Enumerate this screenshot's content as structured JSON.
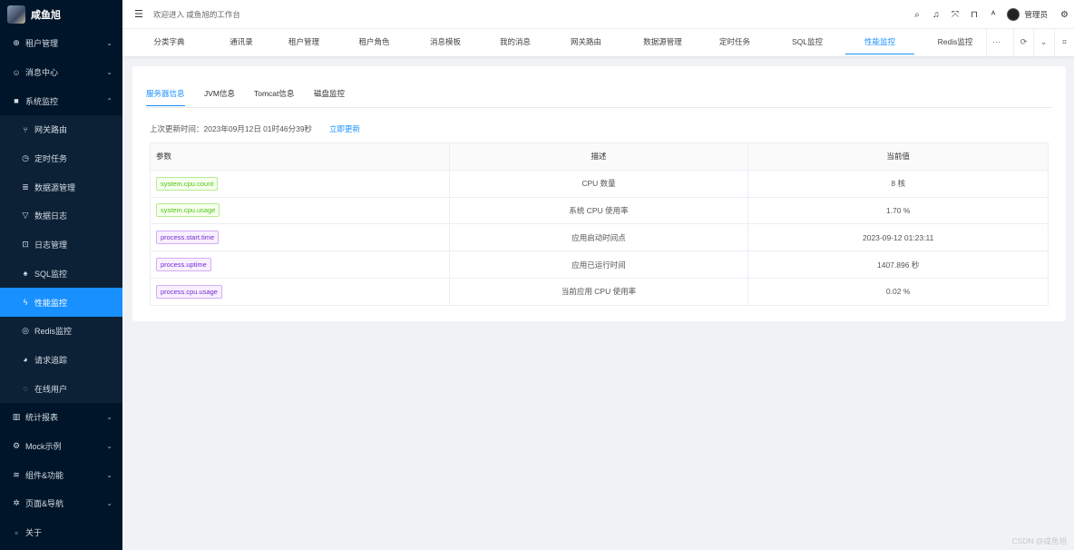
{
  "app": {
    "name": "咸鱼旭"
  },
  "sidebar": {
    "items": [
      {
        "label": "租户管理",
        "icon": "tenant-icon",
        "glyph": "⊕",
        "arrow": "⌄"
      },
      {
        "label": "消息中心",
        "icon": "message-icon",
        "glyph": "☺",
        "arrow": "⌄"
      },
      {
        "label": "系统监控",
        "icon": "monitor-icon",
        "glyph": "■",
        "arrow": "⌃"
      }
    ],
    "monitor_children": [
      {
        "label": "网关路由",
        "icon": "route-icon",
        "glyph": "⑂"
      },
      {
        "label": "定时任务",
        "icon": "clock-icon",
        "glyph": "◷"
      },
      {
        "label": "数据源管理",
        "icon": "database-icon",
        "glyph": "≣"
      },
      {
        "label": "数据日志",
        "icon": "filter-icon",
        "glyph": "▽"
      },
      {
        "label": "日志管理",
        "icon": "log-icon",
        "glyph": "⊡"
      },
      {
        "label": "SQL监控",
        "icon": "bell-icon",
        "glyph": "♠"
      },
      {
        "label": "性能监控",
        "icon": "lightning-icon",
        "glyph": "ϟ",
        "active": true
      },
      {
        "label": "Redis监控",
        "icon": "redis-icon",
        "glyph": "◎"
      },
      {
        "label": "请求追踪",
        "icon": "compass-icon",
        "glyph": "◕"
      },
      {
        "label": "在线用户",
        "icon": "user-online-icon",
        "glyph": "◌"
      }
    ],
    "bottom_items": [
      {
        "label": "统计报表",
        "icon": "chart-icon",
        "glyph": "▥",
        "arrow": "⌄"
      },
      {
        "label": "Mock示例",
        "icon": "gear-icon",
        "glyph": "⚙",
        "arrow": "⌄"
      },
      {
        "label": "组件&功能",
        "icon": "layers-icon",
        "glyph": "≋",
        "arrow": "⌄"
      },
      {
        "label": "页面&导航",
        "icon": "settings-icon",
        "glyph": "✲",
        "arrow": "⌄"
      },
      {
        "label": "关于",
        "icon": "info-icon",
        "glyph": "▫"
      }
    ]
  },
  "header": {
    "welcome": "欢迎进入 咸鱼旭的工作台",
    "username": "管理员"
  },
  "tabs": {
    "items": [
      "分类字典",
      "通讯录",
      "租户管理",
      "租户角色",
      "消息模板",
      "我的消息",
      "网关路由",
      "数据源管理",
      "定时任务",
      "SQL监控",
      "性能监控",
      "Redis监控"
    ],
    "active": "性能监控",
    "more": "···"
  },
  "main": {
    "subtabs": [
      "服务器信息",
      "JVM信息",
      "Tomcat信息",
      "磁盘监控"
    ],
    "active_subtab": "服务器信息",
    "updated_text": "上次更新时间：2023年09月12日 01时46分39秒",
    "refresh_label": "立即更新",
    "table": {
      "headers": [
        "参数",
        "描述",
        "当前值"
      ],
      "rows": [
        {
          "param": "system.cpu.count",
          "tag": "green",
          "desc": "CPU 数量",
          "value": "8 核"
        },
        {
          "param": "system.cpu.usage",
          "tag": "green",
          "desc": "系统 CPU 使用率",
          "value": "1.70 %"
        },
        {
          "param": "process.start.time",
          "tag": "purple",
          "desc": "应用启动时间点",
          "value": "2023-09-12 01:23:11"
        },
        {
          "param": "process.uptime",
          "tag": "purple",
          "desc": "应用已运行时间",
          "value": "1407.896 秒"
        },
        {
          "param": "process.cpu.usage",
          "tag": "purple",
          "desc": "当前应用 CPU 使用率",
          "value": "0.02 %"
        }
      ]
    }
  },
  "watermark": "CSDN @咸鱼旭"
}
